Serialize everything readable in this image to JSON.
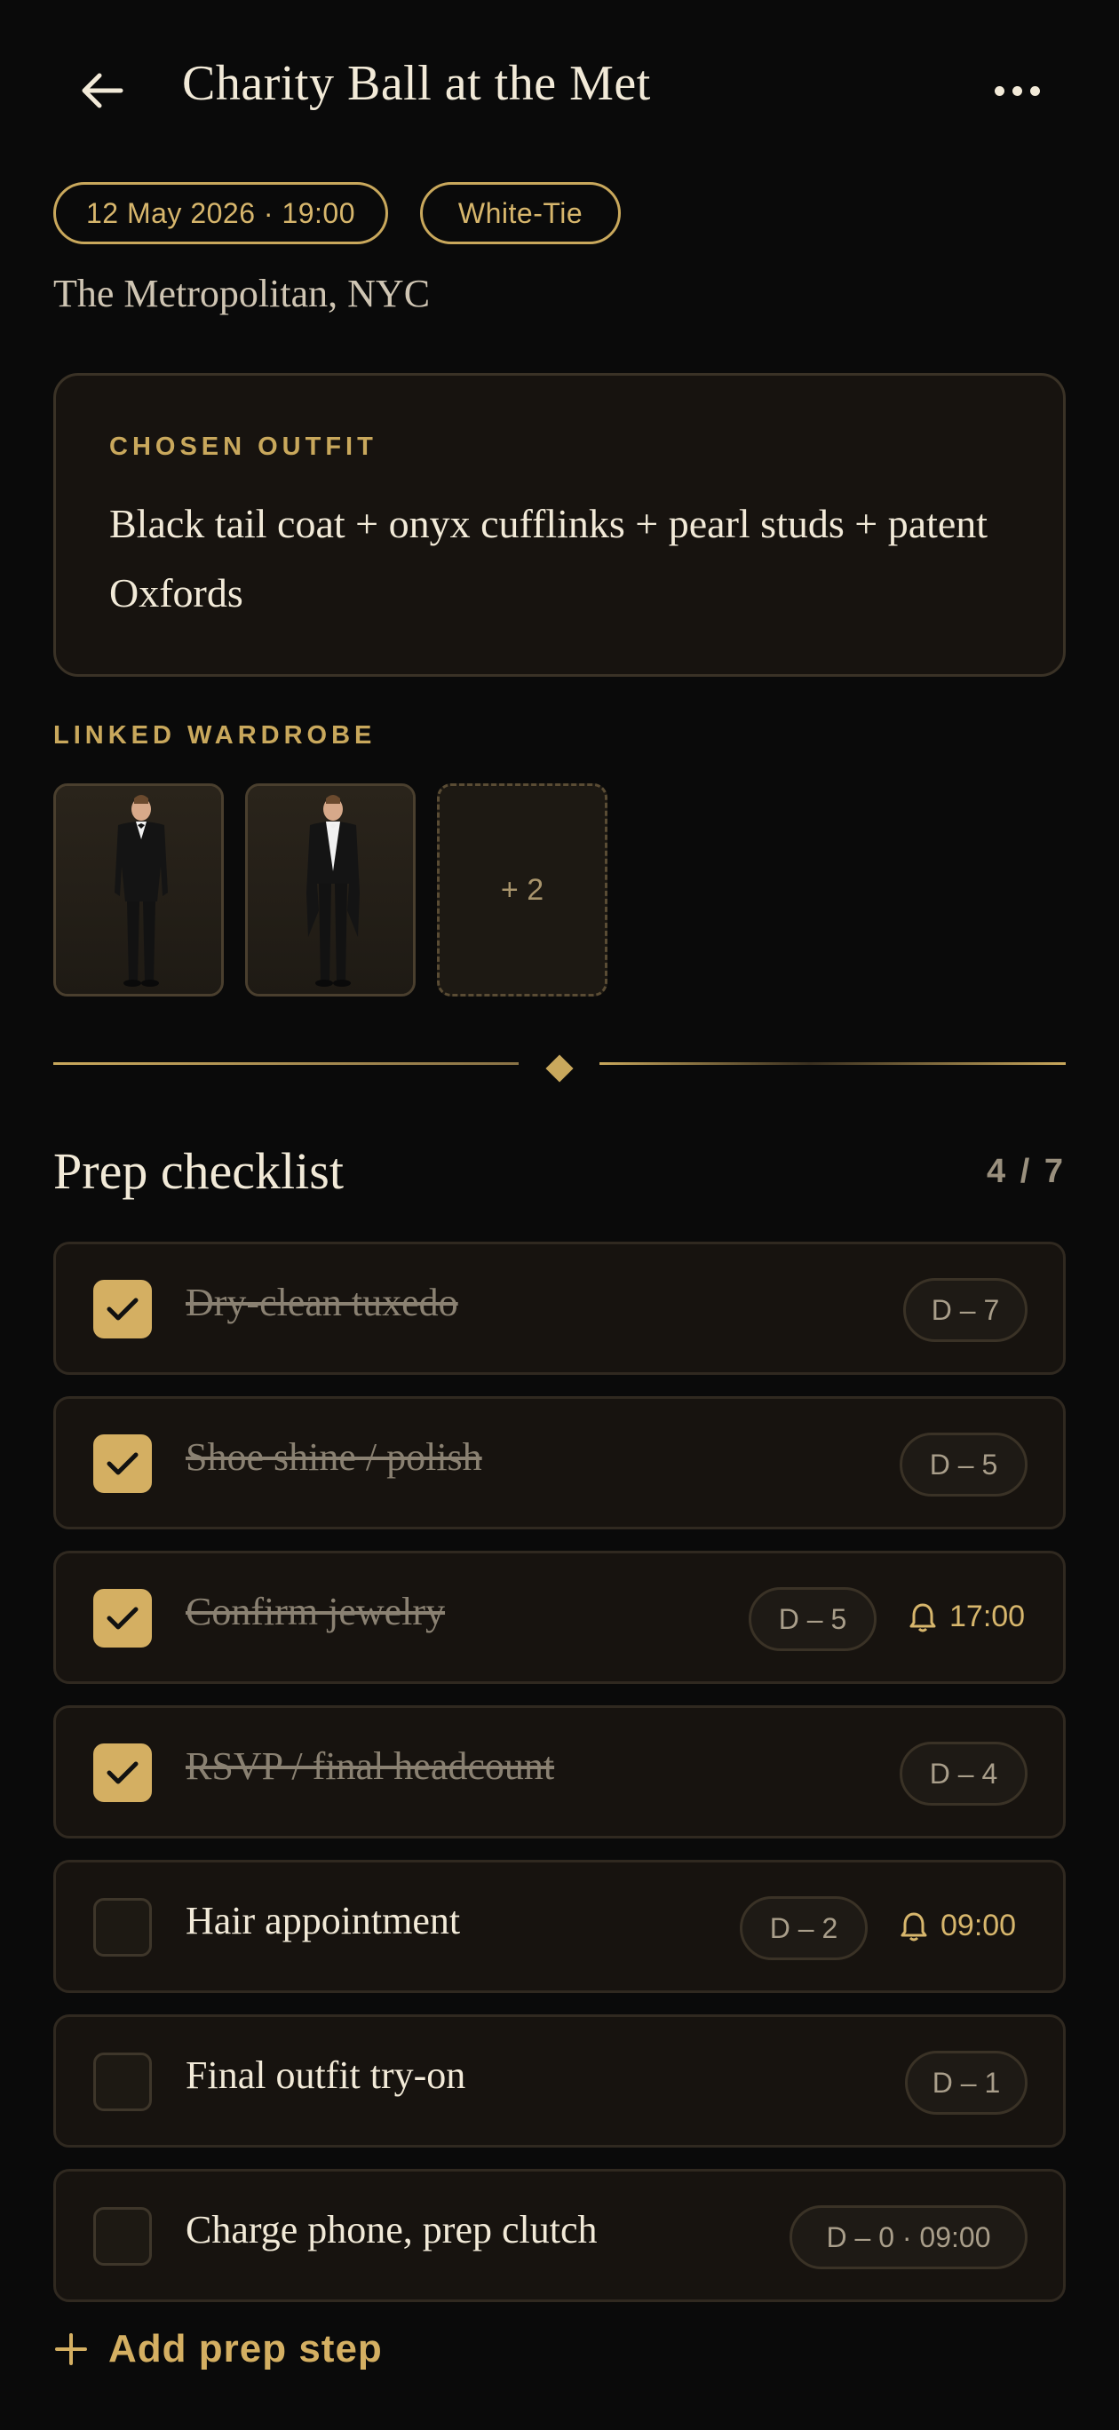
{
  "header": {
    "title": "Charity Ball at the Met",
    "date_pill": "12 May 2026 · 19:00",
    "dress_code_pill": "White-Tie",
    "venue": "The Metropolitan, NYC"
  },
  "outfit": {
    "label": "CHOSEN OUTFIT",
    "text": "Black tail coat + onyx cufflinks + pearl studs + patent Oxfords"
  },
  "wardrobe": {
    "label": "LINKED WARDROBE",
    "more_label": "+ 2"
  },
  "checklist": {
    "title": "Prep checklist",
    "count": "4 / 7",
    "items": [
      {
        "label": "Dry-clean tuxedo",
        "due": "D – 7",
        "done": true
      },
      {
        "label": "Shoe shine / polish",
        "due": "D – 5",
        "done": true
      },
      {
        "label": "Confirm jewelry",
        "due": "D – 5",
        "reminder": "17:00",
        "done": true
      },
      {
        "label": "RSVP / final headcount",
        "due": "D – 4",
        "done": true
      },
      {
        "label": "Hair appointment",
        "due": "D – 2",
        "reminder": "09:00",
        "done": false
      },
      {
        "label": "Final outfit try-on",
        "due": "D – 1",
        "done": false
      },
      {
        "label": "Charge phone, prep clutch",
        "due": "D – 0 · 09:00",
        "done": false
      }
    ]
  },
  "add_step_label": "Add prep step",
  "colors": {
    "background": "#0a0a0a",
    "card": "#17130f",
    "gold_accent": "#c9a85c",
    "text_primary": "#f2ead8",
    "text_muted": "#8a8172"
  }
}
